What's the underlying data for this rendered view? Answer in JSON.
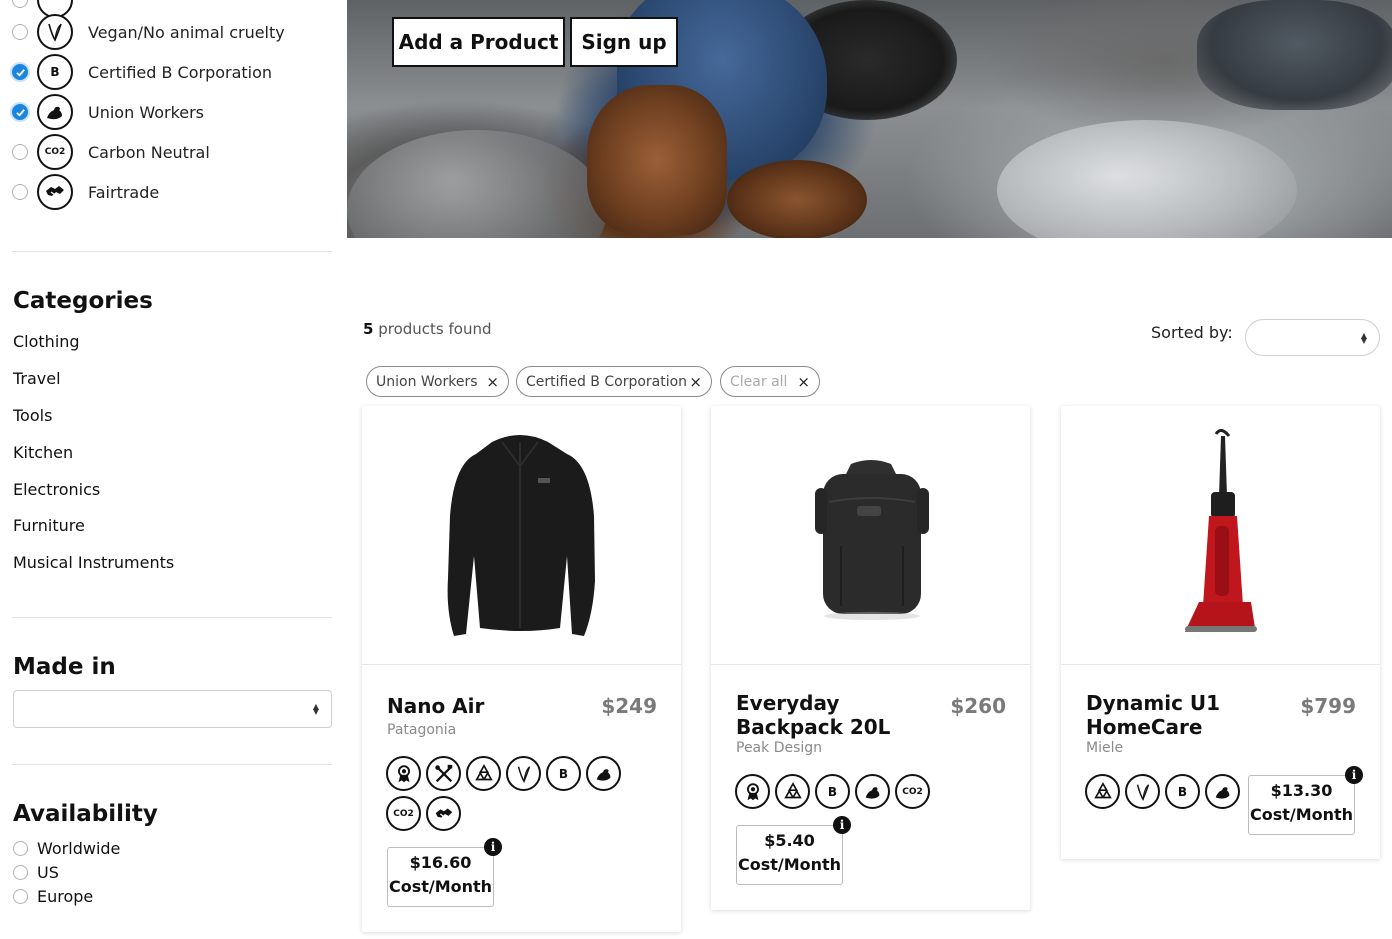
{
  "sidebar": {
    "values": [
      {
        "label": "Vegan/No animal cruelty",
        "icon": "vegan-leaf-icon",
        "checked": false
      },
      {
        "label": "Certified B Corporation",
        "icon": "b-corp-icon",
        "checked": true
      },
      {
        "label": "Union Workers",
        "icon": "union-arm-icon",
        "checked": true
      },
      {
        "label": "Carbon Neutral",
        "icon": "co2-icon",
        "checked": false
      },
      {
        "label": "Fairtrade",
        "icon": "fairtrade-handshake-icon",
        "checked": false
      }
    ],
    "categories": {
      "title": "Categories",
      "items": [
        "Clothing",
        "Travel",
        "Tools",
        "Kitchen",
        "Electronics",
        "Furniture",
        "Musical Instruments"
      ]
    },
    "made_in": {
      "title": "Made in",
      "selected": ""
    },
    "availability": {
      "title": "Availability",
      "options": [
        "Worldwide",
        "US",
        "Europe"
      ]
    }
  },
  "hero": {
    "add_product_label": "Add a Product",
    "signup_label": "Sign up"
  },
  "results": {
    "count": "5",
    "count_suffix": "products found",
    "sorted_by_label": "Sorted by:",
    "sort_selected": "",
    "active_filters": [
      "Union Workers",
      "Certified B Corporation"
    ],
    "clear_all_label": "Clear all",
    "remove_glyph": "×"
  },
  "products": [
    {
      "name": "Nano Air",
      "brand": "Patagonia",
      "price": "$249",
      "cost_value": "$16.60",
      "cost_unit": "Cost/Month",
      "badges": [
        "award-icon",
        "tools-icon",
        "recycle-icon",
        "vegan-leaf-icon",
        "b-corp-icon",
        "union-arm-icon",
        "co2-icon",
        "fairtrade-handshake-icon"
      ]
    },
    {
      "name": "Everyday Backpack 20L",
      "brand": "Peak Design",
      "price": "$260",
      "cost_value": "$5.40",
      "cost_unit": "Cost/Month",
      "badges": [
        "award-icon",
        "recycle-icon",
        "b-corp-icon",
        "union-arm-icon",
        "co2-icon"
      ]
    },
    {
      "name": "Dynamic U1 HomeCare",
      "brand": "Miele",
      "price": "$799",
      "cost_value": "$13.30",
      "cost_unit": "Cost/Month",
      "badges": [
        "recycle-icon",
        "vegan-leaf-icon",
        "b-corp-icon",
        "union-arm-icon"
      ]
    }
  ],
  "badge_text": {
    "b": "B",
    "co2": "CO2"
  },
  "info_glyph": "i",
  "colors": {
    "accent": "#1a86e0",
    "text": "#111111",
    "muted": "#8a8a8a",
    "price": "#7a7a7a"
  }
}
